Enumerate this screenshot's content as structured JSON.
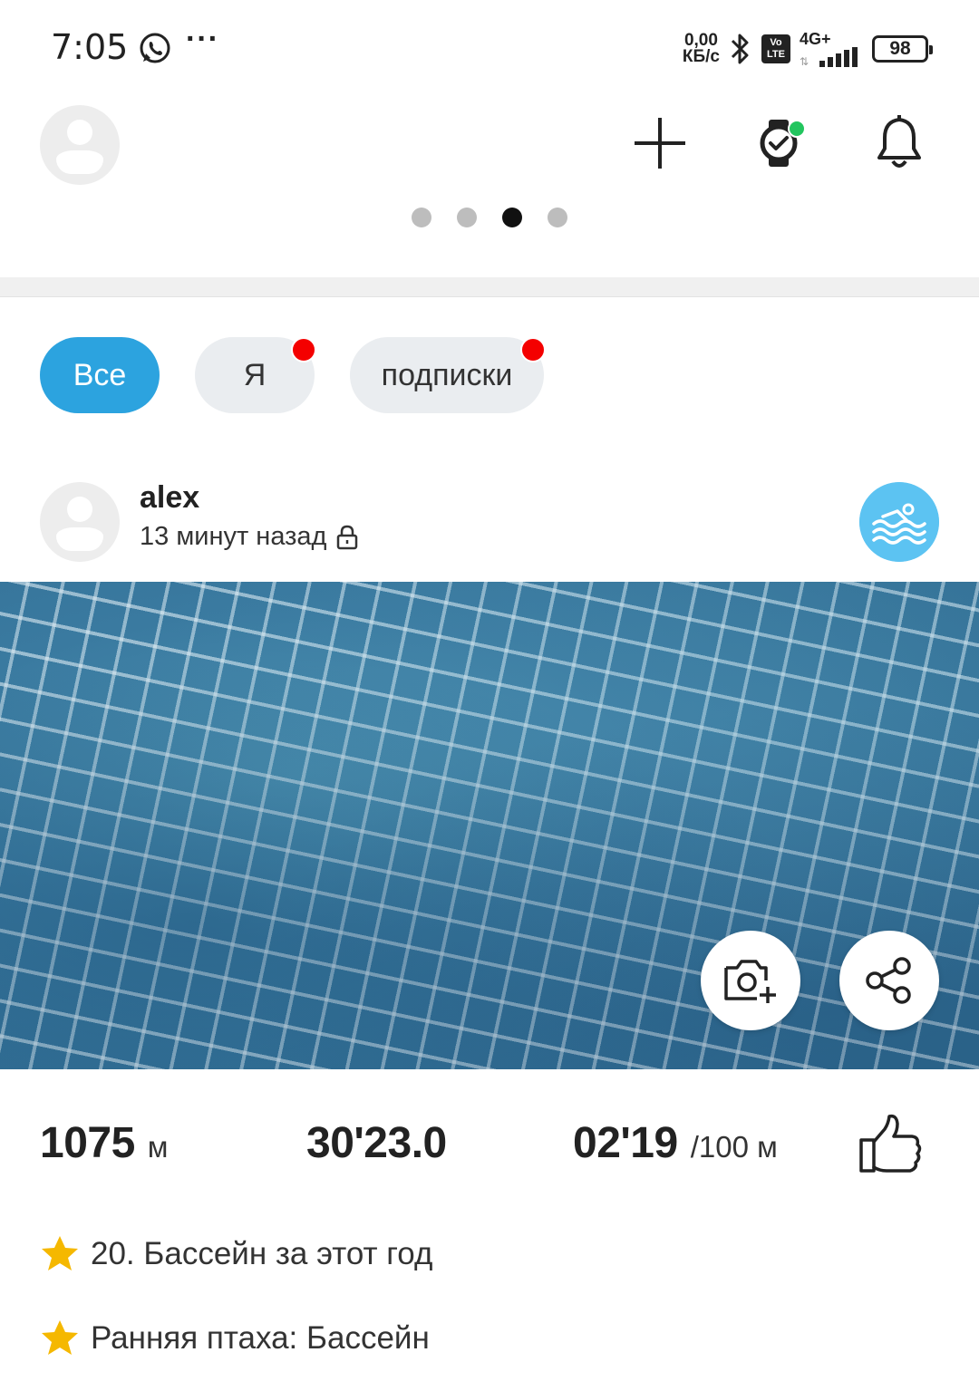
{
  "status_bar": {
    "time": "7:05",
    "speed_value": "0,00",
    "speed_unit": "КБ/с",
    "volte_line1": "Vo",
    "volte_line2": "LTE",
    "network": "4G+",
    "battery": "98"
  },
  "header": {
    "page_indicator": {
      "count": 4,
      "active_index": 2
    }
  },
  "filters": {
    "all": "Все",
    "me": "Я",
    "subscriptions": "подписки"
  },
  "post": {
    "username": "alex",
    "time_ago": "13 минут назад",
    "stats": {
      "distance_value": "1075",
      "distance_unit": "м",
      "duration": "30'23.0",
      "pace_value": "02'19",
      "pace_unit": "/100 м"
    },
    "achievements": [
      {
        "text": "20. Бассейн за этот год"
      },
      {
        "text": "Ранняя птаха: Бассейн"
      }
    ]
  },
  "colors": {
    "accent": "#2ca3df",
    "badge_blue": "#5cc3f2",
    "notification_red": "#f40000",
    "watch_status_green": "#22c55e",
    "star": "#f5b800"
  }
}
